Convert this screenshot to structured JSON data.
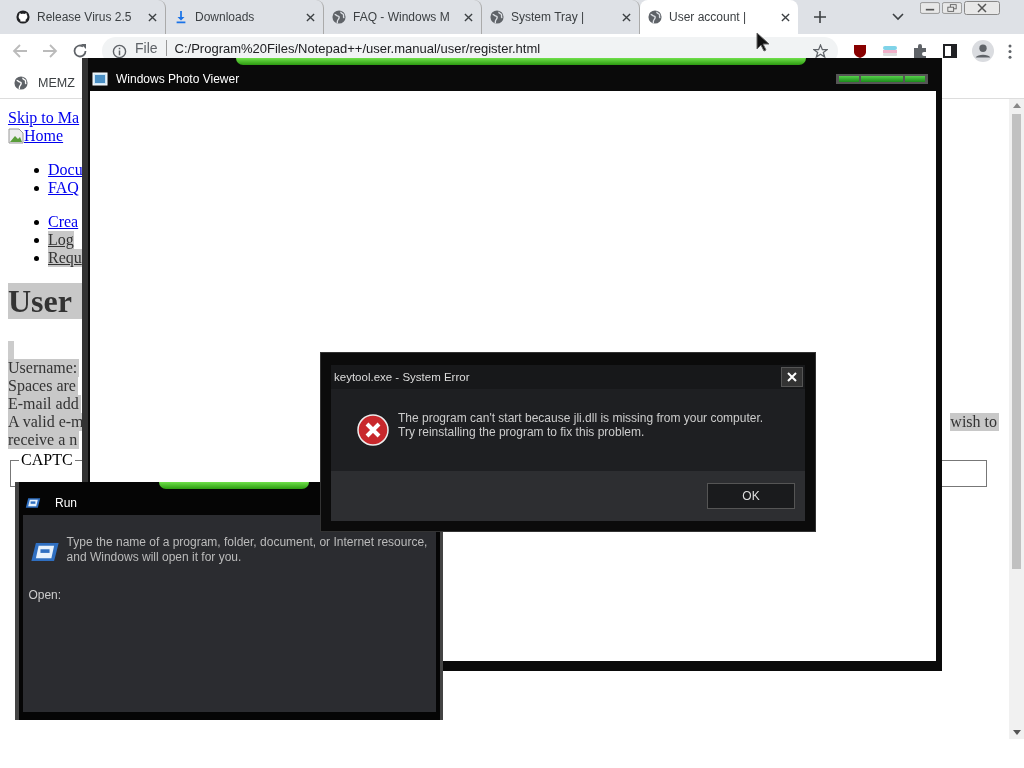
{
  "browser": {
    "tabs": [
      {
        "title": "Release Virus 2.5",
        "kind": "github",
        "selected": false
      },
      {
        "title": "Downloads",
        "kind": "download",
        "selected": false
      },
      {
        "title": "FAQ - Windows M",
        "kind": "globe",
        "selected": false
      },
      {
        "title": "System Tray |",
        "kind": "globe",
        "selected": false
      },
      {
        "title": "User account |",
        "kind": "globe",
        "selected": true
      }
    ],
    "address": {
      "scheme": "File",
      "url": "C:/Program%20Files/Notepad++/user.manual/user/register.html"
    },
    "bookmarks": [
      "MEMZ"
    ]
  },
  "page": {
    "lines": [
      {
        "kind": "link",
        "text": "Skip to Ma",
        "highlight": false
      },
      {
        "kind": "image-link",
        "text": "Home",
        "highlight": false
      },
      {
        "kind": "gap"
      },
      {
        "kind": "bullet",
        "text": "Docu",
        "highlight": false
      },
      {
        "kind": "bullet",
        "text": "FAQ",
        "highlight": false
      },
      {
        "kind": "gap"
      },
      {
        "kind": "bullet",
        "text": "Crea",
        "highlight": false
      },
      {
        "kind": "bullet",
        "text": "Log",
        "highlight": true
      },
      {
        "kind": "bullet",
        "text": "Requ",
        "highlight": true
      },
      {
        "kind": "heading",
        "text": "User",
        "highlight": true
      },
      {
        "kind": "bar"
      },
      {
        "kind": "text",
        "text": "Username:",
        "highlight": true
      },
      {
        "kind": "text",
        "text": "Spaces are",
        "highlight": true
      },
      {
        "kind": "text",
        "text": "E-mail add",
        "highlight": true
      },
      {
        "kind": "text",
        "text": "A valid e-m",
        "right": "wish to",
        "highlight": true
      },
      {
        "kind": "text",
        "text": "receive a n",
        "highlight": true
      },
      {
        "kind": "fieldset",
        "text": "CAPTC"
      }
    ]
  },
  "photo_viewer": {
    "title": "Windows Photo Viewer"
  },
  "error_dialog": {
    "title": "keytool.exe - System Error",
    "message": [
      "The program can't start because jli.dll is missing from your computer.",
      "Try reinstalling the program to fix this problem."
    ],
    "buttons": [
      "OK"
    ]
  },
  "run_dialog": {
    "title": "Run",
    "description": "Type the name of a program, folder, document, or Internet resource, and Windows will open it for you.",
    "open_label": "Open:"
  }
}
